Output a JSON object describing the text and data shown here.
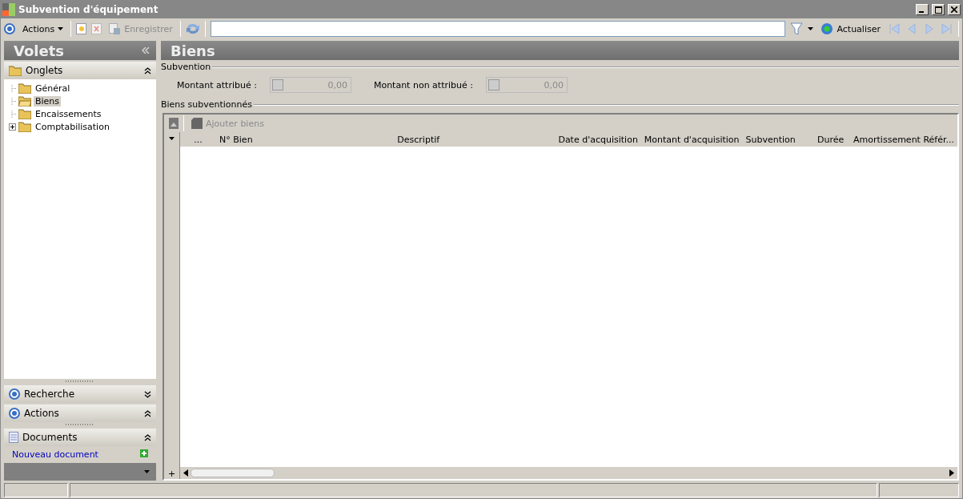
{
  "window": {
    "title": "Subvention d'équipement"
  },
  "toolbar": {
    "actions_label": "Actions",
    "save_label": "Enregistrer",
    "refresh_label": "Actualiser"
  },
  "sidebar": {
    "title": "Volets",
    "sections": [
      {
        "title": "Onglets",
        "kind": "folder",
        "expanded": true,
        "tree": [
          {
            "label": "Général",
            "selected": false,
            "expandable": false
          },
          {
            "label": "Biens",
            "selected": true,
            "expandable": false
          },
          {
            "label": "Encaissements",
            "selected": false,
            "expandable": false
          },
          {
            "label": "Comptabilisation",
            "selected": false,
            "expandable": true
          }
        ]
      },
      {
        "title": "Recherche",
        "kind": "target",
        "expanded": false
      },
      {
        "title": "Actions",
        "kind": "target",
        "expanded": true
      },
      {
        "title": "Documents",
        "kind": "document",
        "expanded": true,
        "links": [
          "Nouveau document"
        ]
      }
    ]
  },
  "main": {
    "title": "Biens",
    "subvention": {
      "legend": "Subvention",
      "fields": [
        {
          "label": "Montant attribué :",
          "value": "0,00"
        },
        {
          "label": "Montant non attribué :",
          "value": "0,00"
        }
      ]
    },
    "grid": {
      "legend": "Biens subventionnés",
      "add_label": "Ajouter biens",
      "columns": [
        "...",
        "N° Bien",
        "Descriptif",
        "Date d'acquisition",
        "Montant d'acquisition",
        "Subvention",
        "Durée",
        "Amortissement Référ..."
      ],
      "add_row": "+"
    }
  }
}
